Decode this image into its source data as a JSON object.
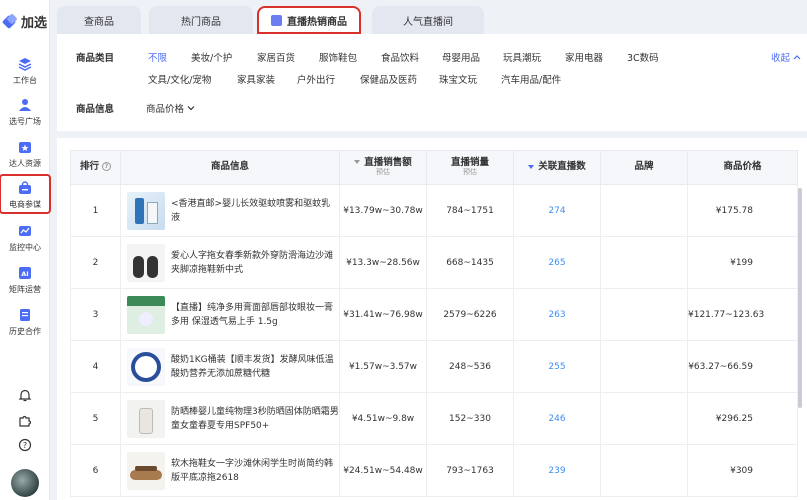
{
  "logo": {
    "text": "加选"
  },
  "sidebar": {
    "items": [
      {
        "label": "工作台",
        "icon": "layers-icon"
      },
      {
        "label": "选号广场",
        "icon": "person-icon"
      },
      {
        "label": "达人资源",
        "icon": "star-folder-icon"
      },
      {
        "label": "电商参谋",
        "icon": "shopping-bag-icon"
      },
      {
        "label": "监控中心",
        "icon": "monitor-chart-icon"
      },
      {
        "label": "矩阵运营",
        "icon": "ai-doc-icon"
      },
      {
        "label": "历史合作",
        "icon": "history-doc-icon"
      }
    ],
    "bottom": [
      "bell-icon",
      "puzzle-icon",
      "help-icon"
    ]
  },
  "tabs": [
    {
      "label": "查商品"
    },
    {
      "label": "热门商品"
    },
    {
      "label": "直播热销商品"
    },
    {
      "label": "人气直播间"
    }
  ],
  "filter": {
    "category_label": "商品类目",
    "row1": [
      "不限",
      "美妆/个护",
      "家居百货",
      "服饰鞋包",
      "食品饮料",
      "母婴用品",
      "玩具潮玩",
      "家用电器",
      "3C数码"
    ],
    "row2": [
      "文具/文化/宠物",
      "家具家装",
      "户外出行",
      "保健品及医药",
      "珠宝文玩",
      "汽车用品/配件"
    ],
    "collapse": "收起",
    "info_label": "商品信息",
    "price_dropdown": "商品价格"
  },
  "table": {
    "headers": {
      "rank": "排行",
      "info": "商品信息",
      "sales_amount": "直播销售额",
      "sales_amount_sub": "预估",
      "sales_volume": "直播销量",
      "sales_volume_sub": "预估",
      "related": "关联直播数",
      "brand": "品牌",
      "price": "商品价格"
    },
    "rows": [
      {
        "rank": "1",
        "name": "<香港直邮>婴儿长效驱蚊喷雾和驱蚊乳液",
        "amount": "¥13.79w~30.78w",
        "volume": "784~1751",
        "related": "274",
        "brand": "",
        "price": "¥175.78"
      },
      {
        "rank": "2",
        "name": "爱心人字拖女春季新款外穿防滑海边沙滩夹脚凉拖鞋新中式",
        "amount": "¥13.3w~28.56w",
        "volume": "668~1435",
        "related": "265",
        "brand": "",
        "price": "¥199"
      },
      {
        "rank": "3",
        "name": "【直播】纯净多用膏面部唇部妆眼妆一膏多用 保湿透气易上手 1.5g",
        "amount": "¥31.41w~76.98w",
        "volume": "2579~6226",
        "related": "263",
        "brand": "",
        "price": "¥121.77~123.63"
      },
      {
        "rank": "4",
        "name": "酸奶1KG桶装【顺丰发货】发酵风味低温酸奶营养无添加蔗糖代糖",
        "amount": "¥1.57w~3.57w",
        "volume": "248~536",
        "related": "255",
        "brand": "",
        "price": "¥63.27~66.59"
      },
      {
        "rank": "5",
        "name": "防晒棒婴儿童纯物理3秒防晒固体防晒霜男童女童春夏专用SPF50+",
        "amount": "¥4.51w~9.8w",
        "volume": "152~330",
        "related": "246",
        "brand": "",
        "price": "¥296.25"
      },
      {
        "rank": "6",
        "name": "软木拖鞋女一字沙滩休闲学生时尚简约韩版平底凉拖2618",
        "amount": "¥24.51w~54.48w",
        "volume": "793~1763",
        "related": "239",
        "brand": "",
        "price": "¥309"
      }
    ]
  },
  "colors": {
    "accent": "#4c6cf5",
    "link": "#3f8ef7",
    "highlight_border": "#d9302c"
  }
}
